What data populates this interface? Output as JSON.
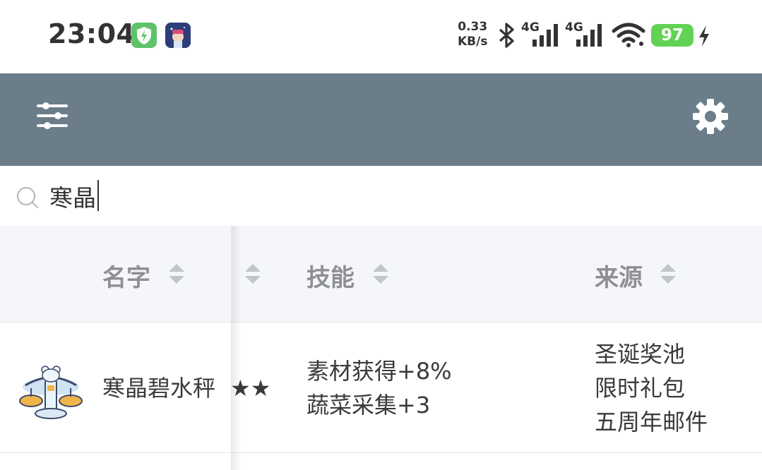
{
  "status_bar": {
    "time": "23:04",
    "net_speed_value": "0.33",
    "net_speed_unit": "KB/s",
    "signal_1_label": "4G",
    "signal_2_label": "4G",
    "battery": "97",
    "icons": [
      "shield-app-icon",
      "game-app-icon",
      "bluetooth-icon",
      "signal-icon",
      "wifi-icon",
      "charging-icon"
    ]
  },
  "toolbar": {
    "left_icon": "filter-sliders-icon",
    "right_icon": "gear-icon",
    "color": "#6a7d89"
  },
  "search": {
    "icon": "search-icon",
    "value": "寒晶"
  },
  "table": {
    "columns": [
      {
        "label": "名字",
        "sortable": true
      },
      {
        "label": "",
        "sortable": true
      },
      {
        "label": "技能",
        "sortable": true
      },
      {
        "label": "来源",
        "sortable": true
      }
    ],
    "rows": [
      {
        "icon": "scale-item-icon",
        "name": "寒晶碧水秤",
        "stars": "★★",
        "skills": [
          "素材获得+8%",
          "蔬菜采集+3"
        ],
        "sources": [
          "圣诞奖池",
          "限时礼包",
          "五周年邮件"
        ]
      }
    ]
  }
}
